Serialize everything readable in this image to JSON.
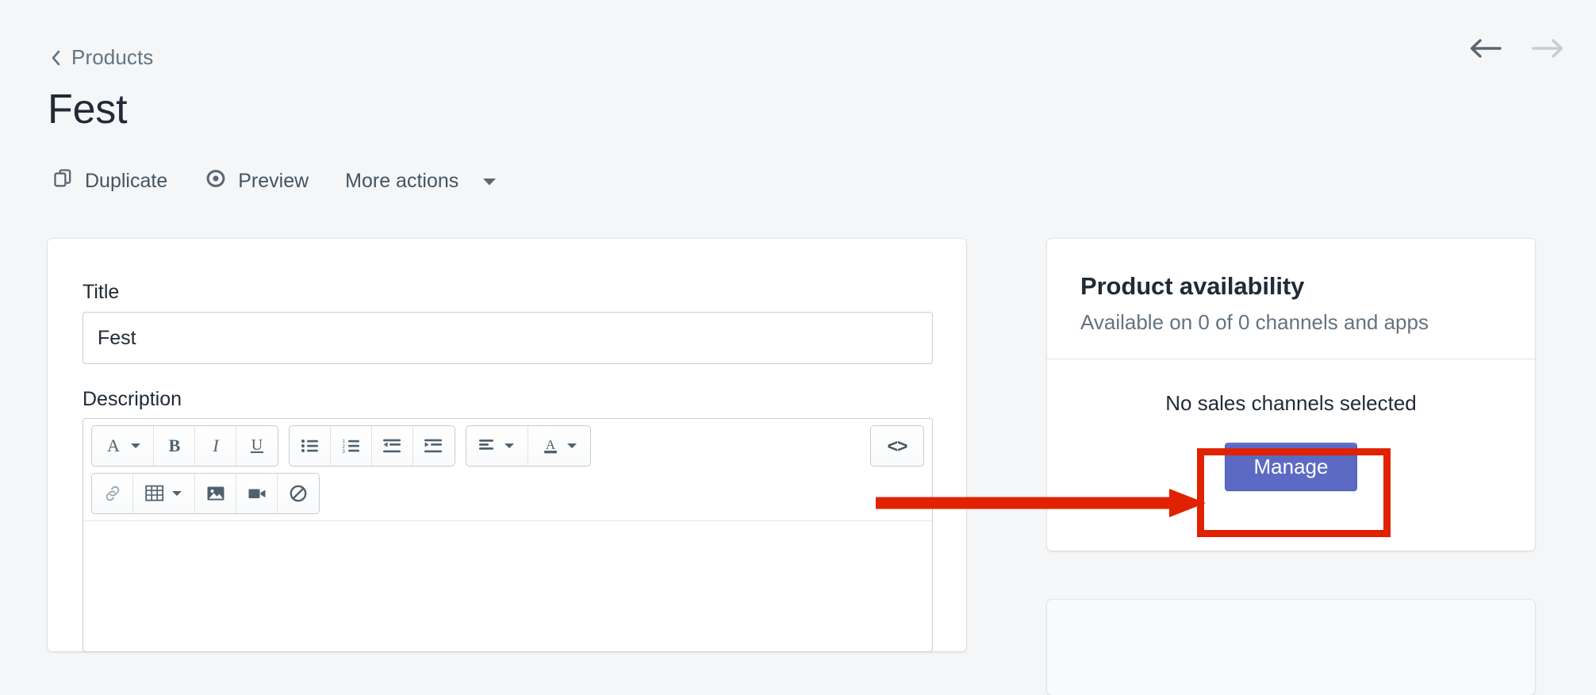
{
  "header": {
    "breadcrumb_label": "Products",
    "breadcrumb_icon": "chevron-left-icon",
    "page_title": "Fest",
    "nav": {
      "prev_icon": "arrow-left-icon",
      "next_icon": "arrow-right-icon"
    },
    "actions": [
      {
        "label": "Duplicate",
        "icon": "duplicate-icon"
      },
      {
        "label": "Preview",
        "icon": "eye-icon"
      },
      {
        "label": "More actions",
        "icon": "caret-down-icon"
      }
    ]
  },
  "main": {
    "title_label": "Title",
    "title_value": "Fest",
    "title_placeholder": "",
    "description_label": "Description",
    "editor": {
      "code_button_label": "<>",
      "row1": [
        {
          "name": "format-style",
          "icon": "font-a-icon",
          "caret": true
        },
        {
          "name": "bold",
          "icon": "bold-icon",
          "caret": false
        },
        {
          "name": "italic",
          "icon": "italic-icon",
          "caret": false
        },
        {
          "name": "underline",
          "icon": "underline-icon",
          "caret": false
        },
        {
          "name": "bulleted-list",
          "icon": "bulleted-list-icon",
          "caret": false
        },
        {
          "name": "numbered-list",
          "icon": "numbered-list-icon",
          "caret": false
        },
        {
          "name": "outdent",
          "icon": "outdent-icon",
          "caret": false
        },
        {
          "name": "indent",
          "icon": "indent-icon",
          "caret": false
        },
        {
          "name": "align",
          "icon": "align-left-icon",
          "caret": true
        },
        {
          "name": "text-color",
          "icon": "text-color-icon",
          "caret": true
        }
      ],
      "row2": [
        {
          "name": "insert-link",
          "icon": "link-icon",
          "caret": false,
          "muted": true
        },
        {
          "name": "insert-table",
          "icon": "table-icon",
          "caret": true
        },
        {
          "name": "insert-image",
          "icon": "image-icon",
          "caret": false
        },
        {
          "name": "insert-video",
          "icon": "video-icon",
          "caret": false
        },
        {
          "name": "clear-formatting",
          "icon": "no-symbol-icon",
          "caret": false
        }
      ],
      "content": ""
    }
  },
  "sidebar": {
    "availability": {
      "title": "Product availability",
      "subtitle": "Available on 0 of 0 channels and apps",
      "empty_text": "No sales channels selected",
      "manage_label": "Manage"
    }
  },
  "colors": {
    "page_background": "#f4f6f8",
    "card_background": "#ffffff",
    "text_primary": "#212b36",
    "text_subdued": "#637381",
    "border": "#c4cdd5",
    "primary_button": "#5c6ac4",
    "annotation": "#e02200"
  }
}
